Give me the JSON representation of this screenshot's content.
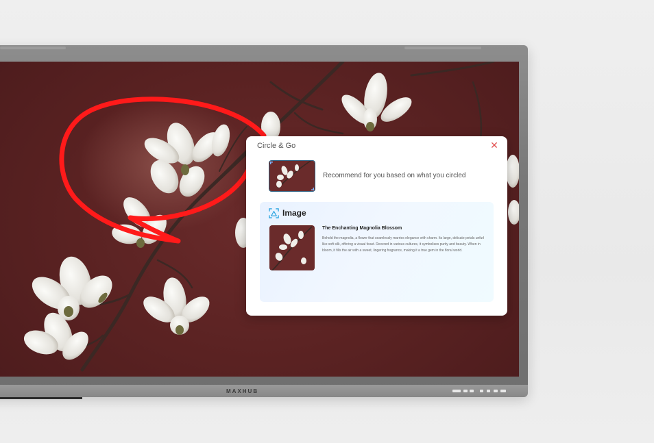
{
  "device": {
    "brand": "MAXHUB"
  },
  "circle_go": {
    "title": "Circle & Go",
    "close_icon": "close-icon",
    "recommend_text": "Recommend for you based on what you circled",
    "section": {
      "icon": "image-icon",
      "title": "Image"
    },
    "result": {
      "title": "The Enchanting Magnolia Blossom",
      "description": "Behold the magnolia, a flower that seamlessly marries elegance with charm. Its large, delicate petals unfurl like soft silk, offering a visual feast. Revered in various cultures, it symbolizes purity and beauty. When in bloom, it fills the air with a sweet, lingering fragrance, making it a true gem in the floral world."
    }
  },
  "colors": {
    "annotation_circle": "#ff1a1a",
    "close": "#e25252",
    "background_wall": "#5a2222"
  }
}
